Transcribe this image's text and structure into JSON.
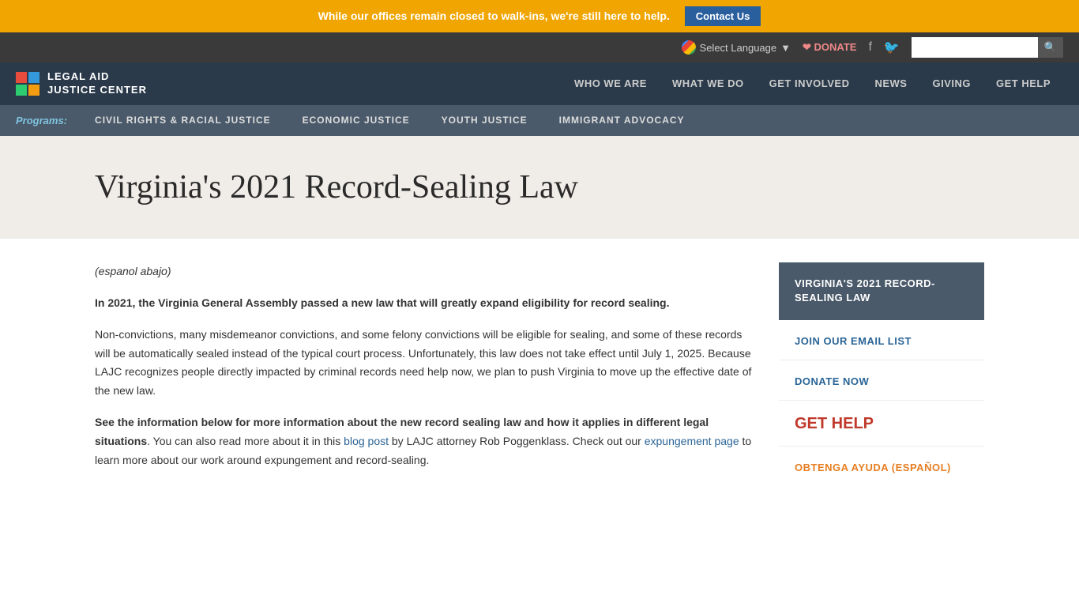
{
  "announcement": {
    "text": "While our offices remain closed to walk-ins, we're still here to help.",
    "contact_btn": "Contact Us"
  },
  "utility": {
    "language_label": "Select Language",
    "language_arrow": "▼",
    "donate_label": "❤ DONATE",
    "facebook_icon": "f",
    "twitter_icon": "🐦",
    "search_placeholder": ""
  },
  "logo": {
    "line1": "LEGAL AID",
    "line2": "JUSTICE CENTER"
  },
  "nav": {
    "items": [
      {
        "label": "WHO WE ARE"
      },
      {
        "label": "WHAT WE DO"
      },
      {
        "label": "GET INVOLVED"
      },
      {
        "label": "NEWS"
      },
      {
        "label": "GIVING"
      },
      {
        "label": "GET HELP"
      }
    ]
  },
  "programs": {
    "label": "Programs:",
    "items": [
      {
        "label": "CIVIL RIGHTS & RACIAL JUSTICE"
      },
      {
        "label": "ECONOMIC JUSTICE"
      },
      {
        "label": "YOUTH JUSTICE"
      },
      {
        "label": "IMMIGRANT ADVOCACY"
      }
    ]
  },
  "page": {
    "title": "Virginia's 2021 Record-Sealing Law"
  },
  "content": {
    "espanol_note": "(espanol abajo)",
    "bold_intro": "In 2021, the Virginia General Assembly passed a new law that will greatly expand eligibility for record sealing.",
    "para1": "Non-convictions, many misdemeanor convictions, and some felony convictions will be eligible for sealing, and some of these records will be automatically sealed instead of the typical court process. Unfortunately, this law does not take effect until July 1, 2025. Because LAJC recognizes people directly impacted by criminal records need help now, we plan to push Virginia to move up the effective date of the new law.",
    "bold_see": "See the information below for more information about the new record sealing law and how it applies in different legal situations",
    "para2_before": ". You can also read more about it in this ",
    "blog_post_link": "blog post",
    "para2_middle": " by LAJC attorney Rob Poggenklass. Check out our ",
    "expungement_link": "expungement page",
    "para2_after": " to learn more about our work around expungement and record-sealing."
  },
  "sidebar": {
    "active_item": "VIRGINIA'S 2021 RECORD-SEALING LAW",
    "links": [
      {
        "label": "JOIN OUR EMAIL LIST",
        "type": "blue"
      },
      {
        "label": "DONATE NOW",
        "type": "blue"
      },
      {
        "label": "GET HELP",
        "type": "red"
      },
      {
        "label": "OBTENGA AYUDA (ESPAÑOL)",
        "type": "orange"
      }
    ]
  }
}
